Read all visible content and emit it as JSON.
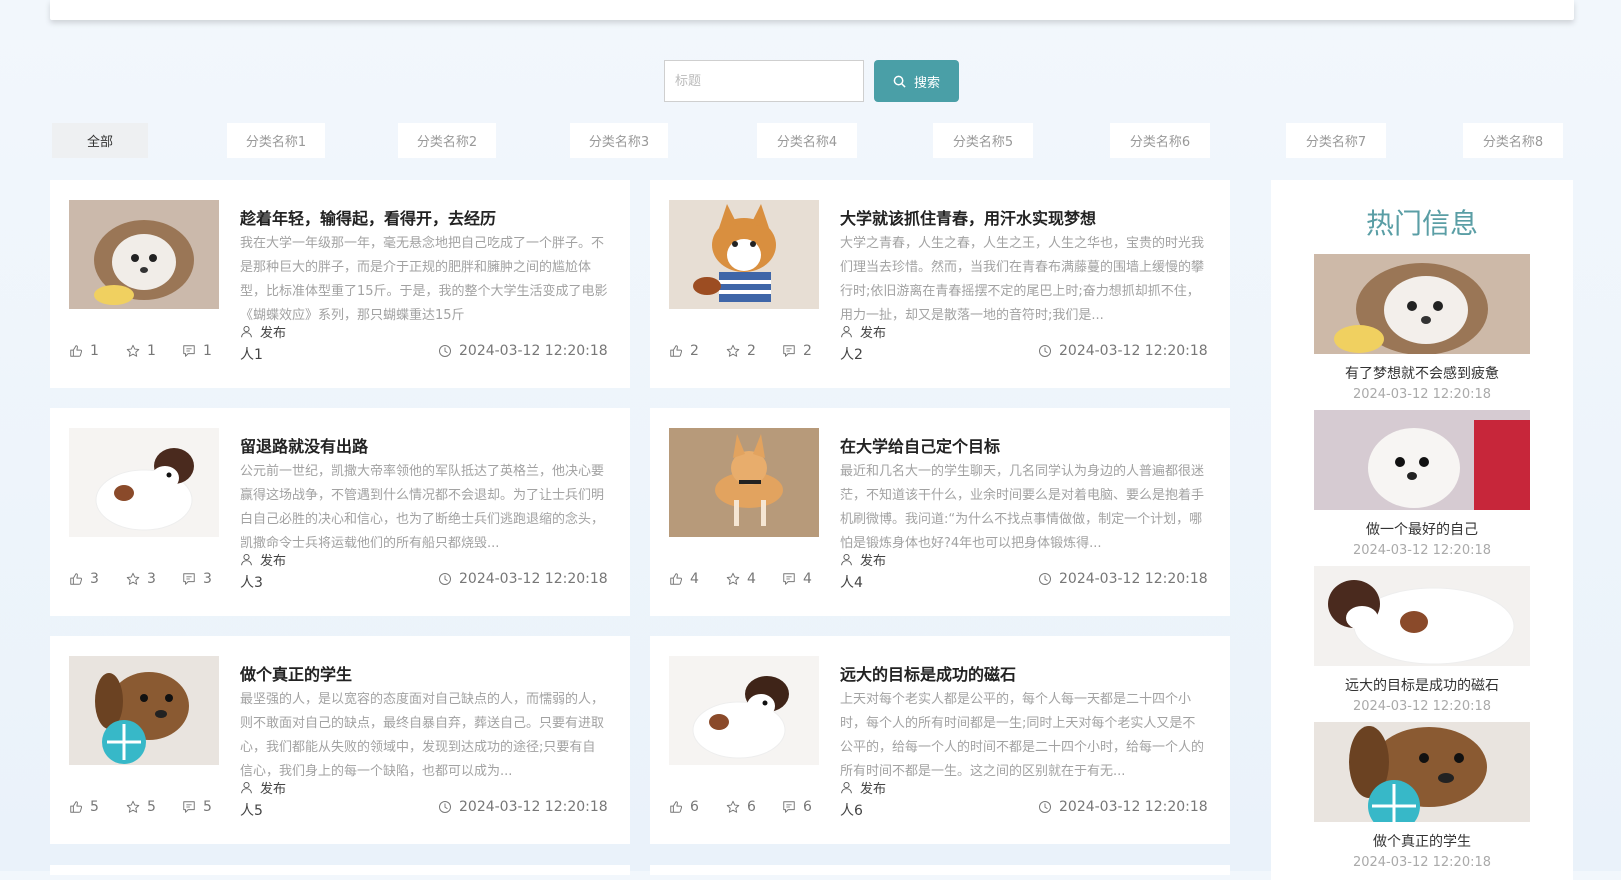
{
  "search": {
    "placeholder": "标题",
    "button_label": "搜索"
  },
  "categories": [
    "全部",
    "分类名称1",
    "分类名称2",
    "分类名称3",
    "分类名称4",
    "分类名称5",
    "分类名称6",
    "分类名称7",
    "分类名称8"
  ],
  "articles": [
    {
      "title": "趁着年轻，输得起，看得开，去经历",
      "desc": "我在大学一年级那一年，毫无悬念地把自己吃成了一个胖子。不是那种巨大的胖子，而是介于正规的肥胖和臃肿之间的尴尬体型，比标准体型重了15斤。于是，我的整个大学生活变成了电影《蝴蝶效应》系列，那只蝴蝶重达15斤",
      "publish": "发布",
      "author": "人1",
      "likes": "1",
      "stars": "1",
      "comments": "1",
      "time": "2024-03-12 12:20:18"
    },
    {
      "title": "大学就该抓住青春，用汗水实现梦想",
      "desc": "大学之青春，人生之春，人生之王，人生之华也，宝贵的时光我们理当去珍惜。然而，当我们在青春布满藤蔓的围墙上缓慢的攀行时;依旧游离在青春摇摆不定的尾巴上时;奋力想抓却抓不住，用力一扯，却又是散落一地的音符时;我们是...",
      "publish": "发布",
      "author": "人2",
      "likes": "2",
      "stars": "2",
      "comments": "2",
      "time": "2024-03-12 12:20:18"
    },
    {
      "title": "留退路就没有出路",
      "desc": "公元前一世纪，凯撒大帝率领他的军队抵达了英格兰，他决心要赢得这场战争，不管遇到什么情况都不会退却。为了让士兵们明白自己必胜的决心和信心，也为了断绝士兵们逃跑退缩的念头，凯撒命令士兵将运载他们的所有船只都烧毁...",
      "publish": "发布",
      "author": "人3",
      "likes": "3",
      "stars": "3",
      "comments": "3",
      "time": "2024-03-12 12:20:18"
    },
    {
      "title": "在大学给自己定个目标",
      "desc": "最近和几名大一的学生聊天，几名同学认为身边的人普遍都很迷茫，不知道该干什么，业余时间要么是对着电脑、要么是抱着手机刷微博。我问道:“为什么不找点事情做做，制定一个计划，哪怕是锻炼身体也好?4年也可以把身体锻炼得...",
      "publish": "发布",
      "author": "人4",
      "likes": "4",
      "stars": "4",
      "comments": "4",
      "time": "2024-03-12 12:20:18"
    },
    {
      "title": "做个真正的学生",
      "desc": "最坚强的人，是以宽容的态度面对自己缺点的人，而懦弱的人，则不敢面对自己的缺点，最终自暴自弃，葬送自己。只要有进取心，我们都能从失败的领域中，发现到达成功的途径;只要有自信心，我们身上的每一个缺陷，也都可以成为...",
      "publish": "发布",
      "author": "人5",
      "likes": "5",
      "stars": "5",
      "comments": "5",
      "time": "2024-03-12 12:20:18"
    },
    {
      "title": "远大的目标是成功的磁石",
      "desc": "上天对每个老实人都是公平的，每个人每一天都是二十四个小时，每个人的所有时间都是一生;同时上天对每个老实人又是不公平的，给每一个人的时间不都是二十四个小时，给每一个人的所有时间不都是一生。这之间的区别就在于有无...",
      "publish": "发布",
      "author": "人6",
      "likes": "6",
      "stars": "6",
      "comments": "6",
      "time": "2024-03-12 12:20:18"
    }
  ],
  "hot": {
    "title": "热门信息",
    "items": [
      {
        "title": "有了梦想就不会感到疲惫",
        "time": "2024-03-12 12:20:18"
      },
      {
        "title": "做一个最好的自己",
        "time": "2024-03-12 12:20:18"
      },
      {
        "title": "远大的目标是成功的磁石",
        "time": "2024-03-12 12:20:18"
      },
      {
        "title": "做个真正的学生",
        "time": "2024-03-12 12:20:18"
      }
    ]
  },
  "icons": {
    "search": "search-icon",
    "like": "thumbs-up-icon",
    "star": "star-icon",
    "comment": "comment-icon",
    "user": "user-icon",
    "clock": "clock-icon"
  },
  "colors": {
    "accent": "#4a9fa7",
    "hot_title": "#5a9ea5"
  }
}
